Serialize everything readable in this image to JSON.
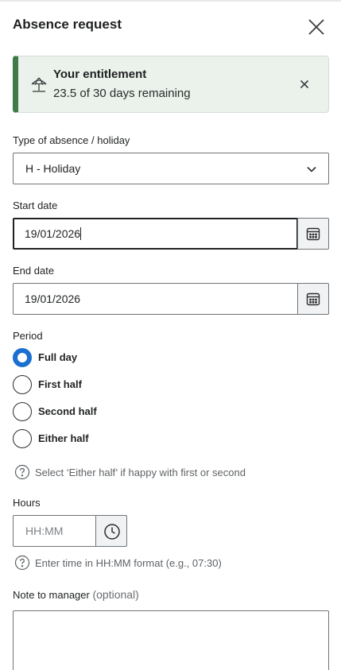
{
  "dialog": {
    "title": "Absence request"
  },
  "entitlement": {
    "title": "Your entitlement",
    "subtitle": "23.5 of 30 days remaining",
    "accent_color": "#3f7b48",
    "icon": "beach-umbrella-icon"
  },
  "absence_type": {
    "label": "Type of absence / holiday",
    "value": "H - Holiday"
  },
  "start_date": {
    "label": "Start date",
    "value": "19/01/2026"
  },
  "end_date": {
    "label": "End date",
    "value": "19/01/2026"
  },
  "period": {
    "label": "Period",
    "options": [
      {
        "label": "Full day",
        "selected": true
      },
      {
        "label": "First half",
        "selected": false
      },
      {
        "label": "Second half",
        "selected": false
      },
      {
        "label": "Either half",
        "selected": false
      }
    ],
    "hint": "Select ‘Either half’ if happy with first or second"
  },
  "hours": {
    "label": "Hours",
    "placeholder": "HH:MM",
    "value": "",
    "hint": "Enter time in HH:MM format (e.g., 07:30)"
  },
  "note": {
    "label": "Note to manager",
    "optional": "(optional)",
    "value": ""
  },
  "colors": {
    "radio_selected": "#1a6fd0"
  }
}
